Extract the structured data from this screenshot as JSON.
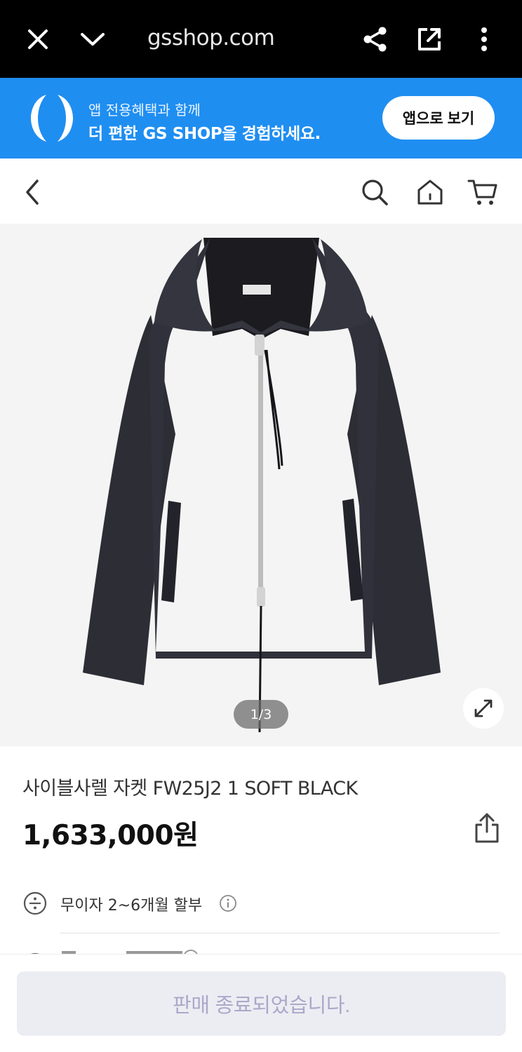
{
  "browser": {
    "url": "gsshop.com",
    "icons": [
      "close-icon",
      "chevron-down-icon",
      "share-icon",
      "open-external-icon",
      "more-vertical-icon"
    ]
  },
  "banner": {
    "line1": "앱 전용혜택과 함께",
    "line2": "더 편한 GS SHOP을 경험하세요.",
    "button_label": "앱으로 보기",
    "color": "#1f8ef1"
  },
  "nav": {
    "icons": [
      "back-icon",
      "search-icon",
      "home-icon",
      "cart-icon"
    ]
  },
  "product": {
    "image_counter": "1/3",
    "title": "사이블사렐 자켓 FW25J2 1 SOFT BLACK",
    "price": "1,633,000원",
    "installment": "무이자 2~6개월 할부"
  },
  "bottom": {
    "button_label": "판매 종료되었습니다."
  }
}
